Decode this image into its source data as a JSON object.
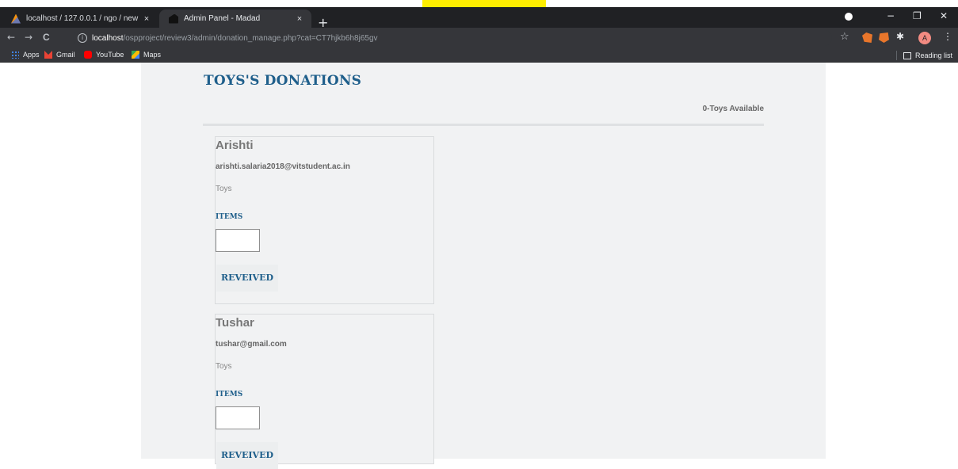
{
  "browser": {
    "tabs": [
      {
        "title": "localhost / 127.0.0.1 / ngo / new",
        "close": "×",
        "active": false
      },
      {
        "title": "Admin Panel - Madad",
        "close": "×",
        "active": true
      }
    ],
    "new_tab": "+",
    "window_controls": {
      "minimize": "−",
      "restore": "❐",
      "close": "✕"
    },
    "nav": {
      "back": "←",
      "forward": "→",
      "reload": "C"
    },
    "address": {
      "info": "i",
      "host": "localhost",
      "path": "/ospproject/review3/admin/donation_manage.php?cat=CT7hjkb6h8j65gv"
    },
    "star": "☆",
    "extension_puzzle": "✱",
    "avatar_letter": "A",
    "menu": "⋮",
    "bookmarks": [
      {
        "label": "Apps"
      },
      {
        "label": "Gmail"
      },
      {
        "label": "YouTube"
      },
      {
        "label": "Maps"
      }
    ],
    "reading_list": "Reading list"
  },
  "page": {
    "heading": "TOYS'S DONATIONS",
    "available": "0-Toys Available",
    "donations": [
      {
        "name": "Arishti",
        "email": "arishti.salaria2018@vitstudent.ac.in",
        "category": "Toys",
        "items_label": "ITEMS",
        "items_value": "",
        "button": "REVEIVED"
      },
      {
        "name": "Tushar",
        "email": "tushar@gmail.com",
        "category": "Toys",
        "items_label": "ITEMS",
        "items_value": "",
        "button": "REVEIVED"
      }
    ]
  },
  "colors": {
    "accent": "#1f5f8b",
    "highlight": "#ffee00",
    "content_bg": "#f1f2f3"
  }
}
